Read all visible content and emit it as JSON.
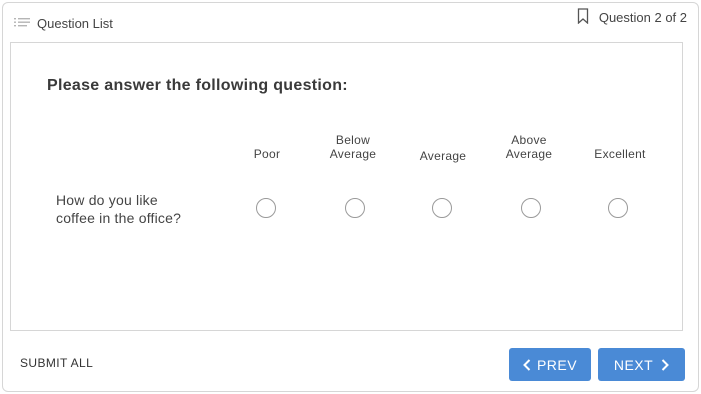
{
  "header": {
    "question_list_label": "Question List",
    "progress_label": "Question 2 of 2"
  },
  "question": {
    "title": "Please answer the following question:",
    "columns": [
      "Poor",
      "Below\nAverage",
      "Average",
      "Above\nAverage",
      "Excellent"
    ],
    "row_label": "How do you like\ncoffee in the office?",
    "selected_index": null
  },
  "footer": {
    "submit_all_label": "SUBMIT ALL",
    "prev_label": "PREV",
    "next_label": "NEXT"
  },
  "colors": {
    "accent": "#4a8ad6",
    "border": "#d6d6d6"
  },
  "icons": {
    "question_list": "list-icon",
    "progress": "bookmark-icon",
    "prev": "chevron-left-icon",
    "next": "chevron-right-icon"
  }
}
